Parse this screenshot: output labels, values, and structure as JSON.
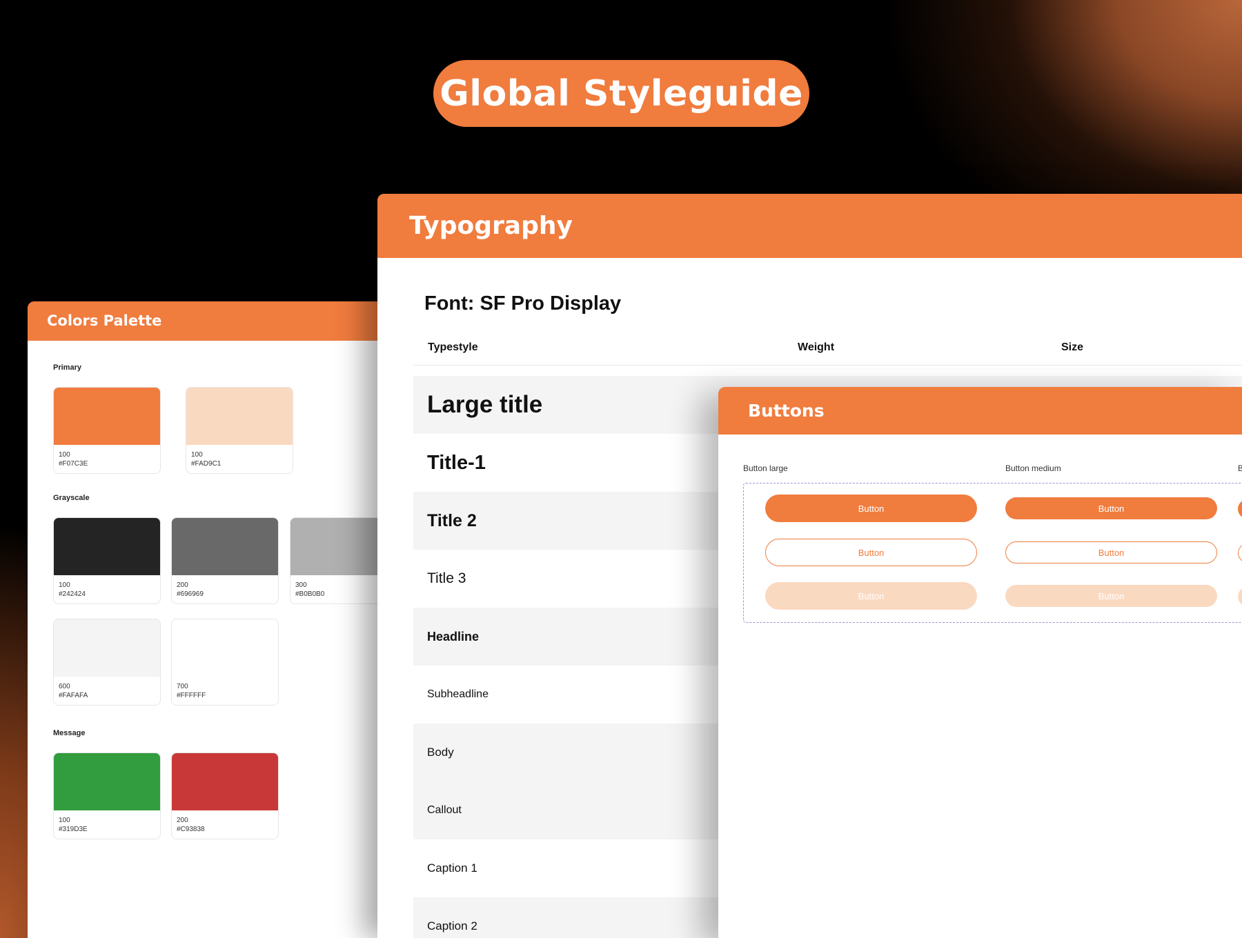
{
  "hero": {
    "title": "Global Styleguide"
  },
  "colors_palette": {
    "title": "Colors Palette",
    "sections": {
      "primary": "Primary",
      "grayscale": "Grayscale",
      "message": "Message"
    },
    "swatches": [
      {
        "level": "100",
        "hex": "#F07C3E",
        "color": "#F07C3E"
      },
      {
        "level": "100",
        "hex": "#FAD9C1",
        "color": "#FAD9C1"
      },
      {
        "level": "100",
        "hex": "#242424",
        "color": "#242424"
      },
      {
        "level": "200",
        "hex": "#696969",
        "color": "#696969"
      },
      {
        "level": "300",
        "hex": "#B0B0B0",
        "color": "#B0B0B0"
      },
      {
        "level": "600",
        "hex": "#FAFAFA",
        "color": "#F4F4F4"
      },
      {
        "level": "700",
        "hex": "#FFFFFF",
        "color": "#FFFFFF"
      },
      {
        "level": "100",
        "hex": "#319D3E",
        "color": "#319D3E"
      },
      {
        "level": "200",
        "hex": "#C93838",
        "color": "#C93838"
      }
    ]
  },
  "typography": {
    "title": "Typography",
    "font_line": "Font: SF Pro Display",
    "columns": {
      "typestyle": "Typestyle",
      "weight": "Weight",
      "size": "Size"
    },
    "rows": [
      {
        "name": "Large title"
      },
      {
        "name": "Title-1"
      },
      {
        "name": "Title 2"
      },
      {
        "name": "Title 3"
      },
      {
        "name": "Headline"
      },
      {
        "name": "Subheadline"
      },
      {
        "name": "Body"
      },
      {
        "name": "Callout"
      },
      {
        "name": "Caption 1"
      },
      {
        "name": "Caption 2"
      }
    ]
  },
  "buttons_panel": {
    "title": "Buttons",
    "labels": {
      "large": "Button large",
      "medium": "Button medium",
      "small_fragment": "B"
    },
    "button_text": "Button"
  },
  "accent_color": "#F07C3E"
}
